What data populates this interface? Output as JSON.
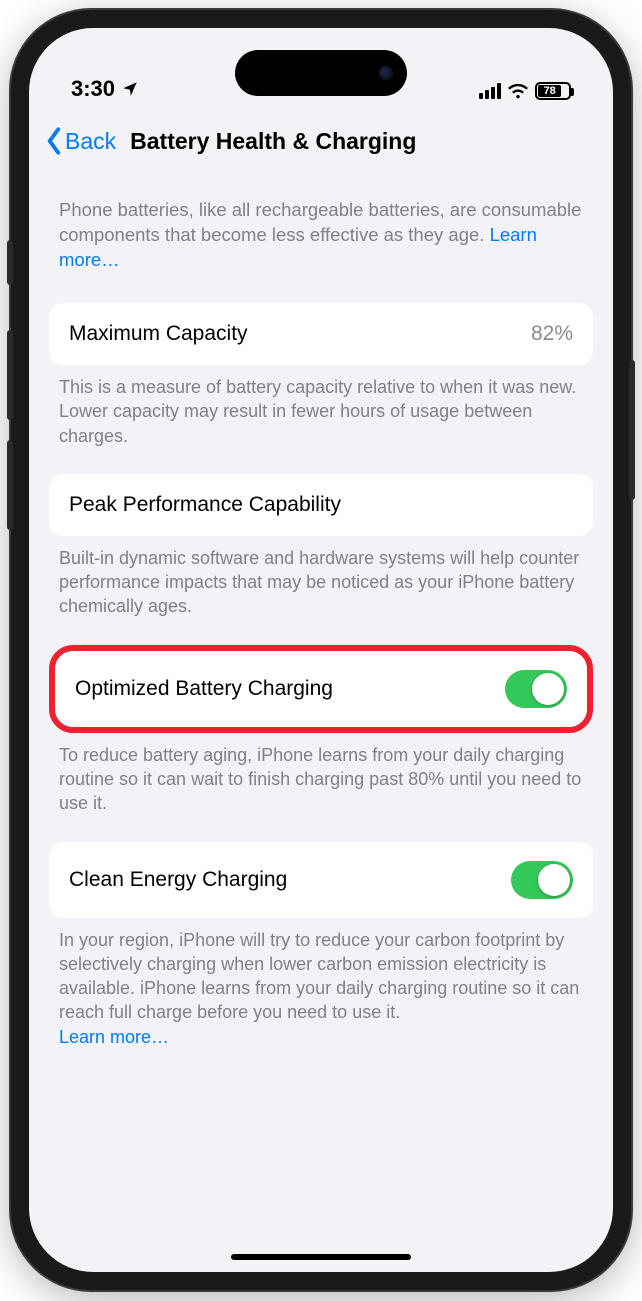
{
  "status": {
    "time": "3:30",
    "battery_percent": "78"
  },
  "nav": {
    "back": "Back",
    "title": "Battery Health & Charging"
  },
  "intro": {
    "text": "Phone batteries, like all rechargeable batteries, are consumable components that become less effective as they age. ",
    "learn_more": "Learn more…"
  },
  "max_capacity": {
    "label": "Maximum Capacity",
    "value": "82%",
    "footer": "This is a measure of battery capacity relative to when it was new. Lower capacity may result in fewer hours of usage between charges."
  },
  "peak_perf": {
    "label": "Peak Performance Capability",
    "footer": "Built-in dynamic software and hardware systems will help counter performance impacts that may be noticed as your iPhone battery chemically ages."
  },
  "optimized": {
    "label": "Optimized Battery Charging",
    "footer": "To reduce battery aging, iPhone learns from your daily charging routine so it can wait to finish charging past 80% until you need to use it."
  },
  "clean_energy": {
    "label": "Clean Energy Charging",
    "footer": "In your region, iPhone will try to reduce your carbon footprint by selectively charging when lower carbon emission electricity is available. iPhone learns from your daily charging routine so it can reach full charge before you need to use it.",
    "learn_more": "Learn more…"
  }
}
